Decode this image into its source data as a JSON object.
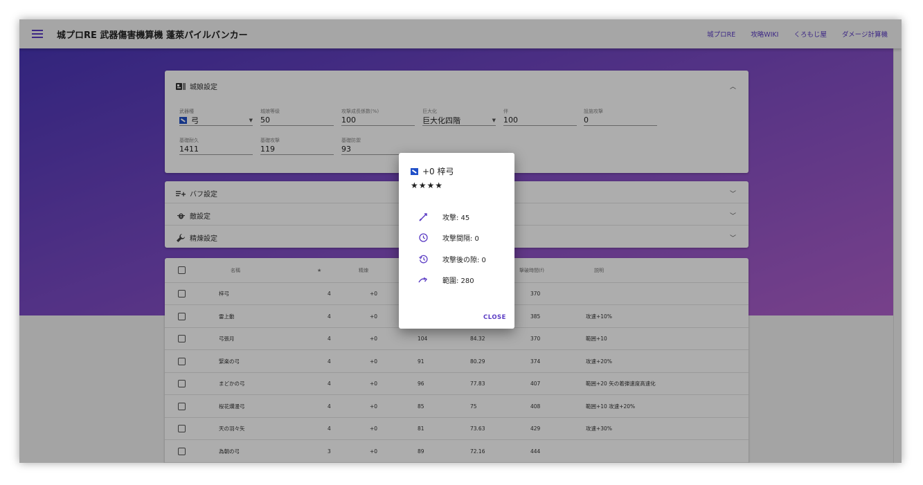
{
  "appbar": {
    "title": "城プロRE 武器傷害機算機 蓬萊パイルバンカー",
    "nav": [
      "城プロRE",
      "攻略WIKI",
      "くろもじ屋",
      "ダメージ計算機"
    ]
  },
  "settings": {
    "title": "城娘設定",
    "fields": [
      {
        "label": "武器種",
        "value": "弓"
      },
      {
        "label": "城娘等级",
        "value": "50"
      },
      {
        "label": "攻撃成長係数(%)",
        "value": "100"
      },
      {
        "label": "巨大化",
        "value": "巨大化四階"
      },
      {
        "label": "伴",
        "value": "100"
      },
      {
        "label": "設施攻撃",
        "value": "0"
      },
      {
        "label": "基礎耐久",
        "value": "1411"
      },
      {
        "label": "基礎攻撃",
        "value": "119"
      },
      {
        "label": "基礎防禦",
        "value": "93"
      }
    ]
  },
  "panels": [
    {
      "label": "バフ設定"
    },
    {
      "label": "敵設定"
    },
    {
      "label": "精煉設定"
    }
  ],
  "table": {
    "headers": [
      "名稱",
      "★",
      "精煉",
      "",
      "",
      "撃破時間(f)",
      "説明"
    ],
    "rows": [
      {
        "name": "梓弓",
        "star": "4",
        "refine": "+0",
        "c4": "",
        "c5": "",
        "time": "370",
        "desc": ""
      },
      {
        "name": "雷上動",
        "star": "4",
        "refine": "+0",
        "c4": "",
        "c5": "",
        "time": "385",
        "desc": "攻速+10%"
      },
      {
        "name": "弓張月",
        "star": "4",
        "refine": "+0",
        "c4": "104",
        "c5": "84.32",
        "time": "370",
        "desc": "範囲+10"
      },
      {
        "name": "緊楽の弓",
        "star": "4",
        "refine": "+0",
        "c4": "91",
        "c5": "80.29",
        "time": "374",
        "desc": "攻速+20%"
      },
      {
        "name": "まどかの弓",
        "star": "4",
        "refine": "+0",
        "c4": "96",
        "c5": "77.83",
        "time": "407",
        "desc": "範囲+20 矢の着弾速度高速化"
      },
      {
        "name": "桜花爛漫弓",
        "star": "4",
        "refine": "+0",
        "c4": "85",
        "c5": "75",
        "time": "408",
        "desc": "範囲+10 攻速+20%"
      },
      {
        "name": "天の羽々矢",
        "star": "4",
        "refine": "+0",
        "c4": "81",
        "c5": "73.63",
        "time": "429",
        "desc": "攻速+30%"
      },
      {
        "name": "為朝の弓",
        "star": "3",
        "refine": "+0",
        "c4": "89",
        "c5": "72.16",
        "time": "444",
        "desc": ""
      }
    ]
  },
  "dialog": {
    "title": "+0 梓弓",
    "stars": "★★★★",
    "stats": [
      {
        "icon": "sword-icon",
        "text": "攻撃: 45"
      },
      {
        "icon": "clock-icon",
        "text": "攻撃間隔: 0"
      },
      {
        "icon": "history-icon",
        "text": "攻撃後の隙: 0"
      },
      {
        "icon": "range-arrow-icon",
        "text": "範圍: 280"
      }
    ],
    "close": "CLOSE"
  },
  "colors": {
    "accent": "#5b3cc4",
    "weapon_icon": "#2150c8",
    "hero_start": "#4a36b8",
    "hero_end": "#b060cc"
  }
}
